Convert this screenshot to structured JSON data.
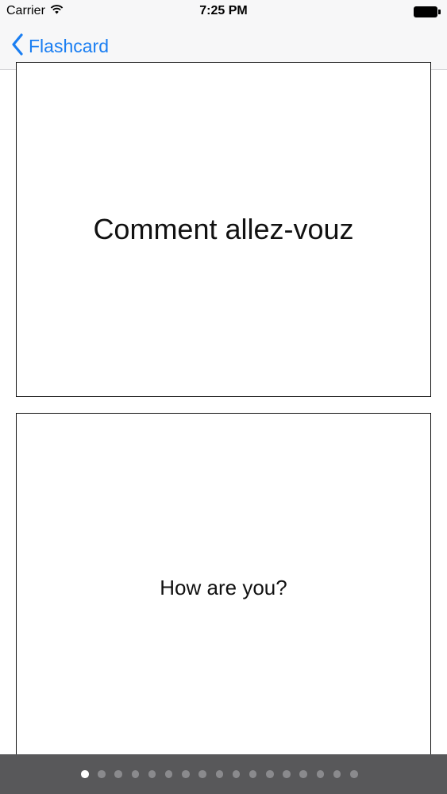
{
  "status_bar": {
    "carrier": "Carrier",
    "time": "7:25 PM",
    "icons": [
      "wifi-icon",
      "battery-icon"
    ]
  },
  "nav_bar": {
    "back_label": "Flashcard",
    "back_icon": "chevron-left-icon",
    "accent_color": "#1a7ef2"
  },
  "cards": {
    "front_text": "Comment allez-vouz",
    "back_text": "How are you?"
  },
  "page_control": {
    "page_count": 17,
    "current_page": 1,
    "active_color": "#ffffff",
    "inactive_color": "#8a8a8d",
    "background_color": "#58585a"
  }
}
